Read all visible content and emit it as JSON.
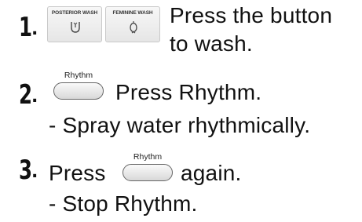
{
  "step1": {
    "number": "1",
    "dot": ".",
    "posterior_button_label": "POSTERIOR WASH",
    "posterior_icon": "posterior-wash-icon",
    "feminine_button_label": "FEMININE WASH",
    "feminine_icon": "feminine-wash-icon",
    "text_line1": "Press the button",
    "text_line2": "to wash."
  },
  "step2": {
    "number": "2",
    "dot": ".",
    "button_label": "Rhythm",
    "text": "Press Rhythm.",
    "note": "- Spray water rhythmically."
  },
  "step3": {
    "number": "3",
    "dot": ".",
    "text_before": "Press",
    "button_label": "Rhythm",
    "text_after": "again.",
    "note": "- Stop Rhythm."
  }
}
